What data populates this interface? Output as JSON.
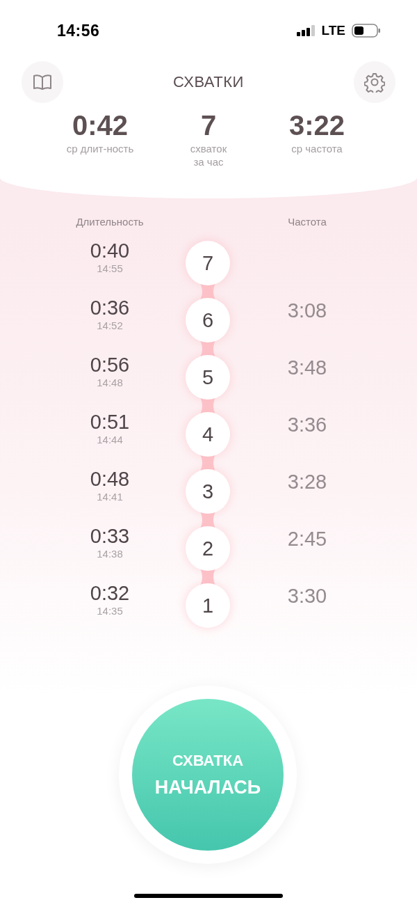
{
  "status_bar": {
    "time": "14:56",
    "network": "LTE"
  },
  "header": {
    "title": "СХВАТКИ"
  },
  "stats": [
    {
      "value": "0:42",
      "label": "ср длит-ность"
    },
    {
      "value": "7",
      "label": "схваток\nза час"
    },
    {
      "value": "3:22",
      "label": "ср частота"
    }
  ],
  "columns": {
    "duration": "Длительность",
    "frequency": "Частота"
  },
  "contractions": [
    {
      "number": "7",
      "duration": "0:40",
      "time": "14:55"
    },
    {
      "number": "6",
      "duration": "0:36",
      "time": "14:52"
    },
    {
      "number": "5",
      "duration": "0:56",
      "time": "14:48"
    },
    {
      "number": "4",
      "duration": "0:51",
      "time": "14:44"
    },
    {
      "number": "3",
      "duration": "0:48",
      "time": "14:41"
    },
    {
      "number": "2",
      "duration": "0:33",
      "time": "14:38"
    },
    {
      "number": "1",
      "duration": "0:32",
      "time": "14:35"
    }
  ],
  "frequencies": [
    "3:08",
    "3:48",
    "3:36",
    "3:28",
    "2:45",
    "3:30"
  ],
  "start_button": {
    "line1": "СХВАТКА",
    "line2": "НАЧАЛАСЬ"
  }
}
